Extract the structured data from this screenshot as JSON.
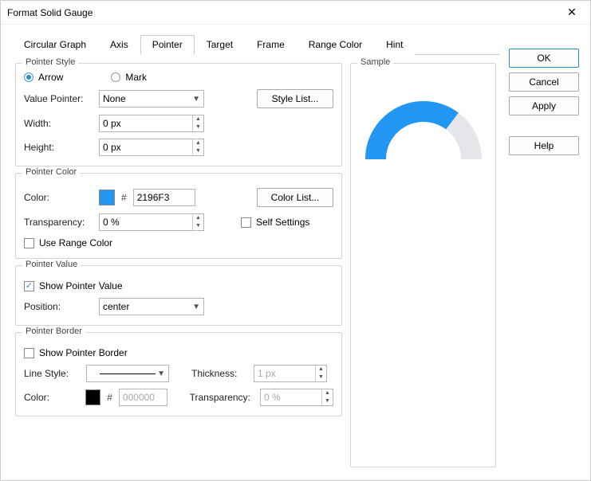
{
  "window": {
    "title": "Format Solid Gauge"
  },
  "tabs": [
    "Circular Graph",
    "Axis",
    "Pointer",
    "Target",
    "Frame",
    "Range Color",
    "Hint"
  ],
  "activeTab": 2,
  "sampleLegend": "Sample",
  "buttons": {
    "ok": "OK",
    "cancel": "Cancel",
    "apply": "Apply",
    "help": "Help",
    "styleList": "Style List...",
    "colorList": "Color List..."
  },
  "pointerStyle": {
    "legend": "Pointer Style",
    "arrow": "Arrow",
    "mark": "Mark",
    "selected": "arrow",
    "valuePointerLabel": "Value Pointer:",
    "valuePointer": "None",
    "widthLabel": "Width:",
    "width": "0 px",
    "heightLabel": "Height:",
    "height": "0 px"
  },
  "pointerColor": {
    "legend": "Pointer Color",
    "colorLabel": "Color:",
    "color": "#2196F3",
    "hex": "2196F3",
    "transparencyLabel": "Transparency:",
    "transparency": "0 %",
    "selfSettings": "Self Settings",
    "selfSettingsChecked": false,
    "useRangeColor": "Use Range Color",
    "useRangeColorChecked": false
  },
  "pointerValue": {
    "legend": "Pointer Value",
    "show": "Show Pointer Value",
    "showChecked": true,
    "positionLabel": "Position:",
    "position": "center"
  },
  "pointerBorder": {
    "legend": "Pointer Border",
    "show": "Show Pointer Border",
    "showChecked": false,
    "lineStyleLabel": "Line Style:",
    "thicknessLabel": "Thickness:",
    "thickness": "1 px",
    "colorLabel": "Color:",
    "color": "#000000",
    "hex": "000000",
    "transparencyLabel": "Transparency:",
    "transparency": "0 %"
  },
  "hash": "#"
}
